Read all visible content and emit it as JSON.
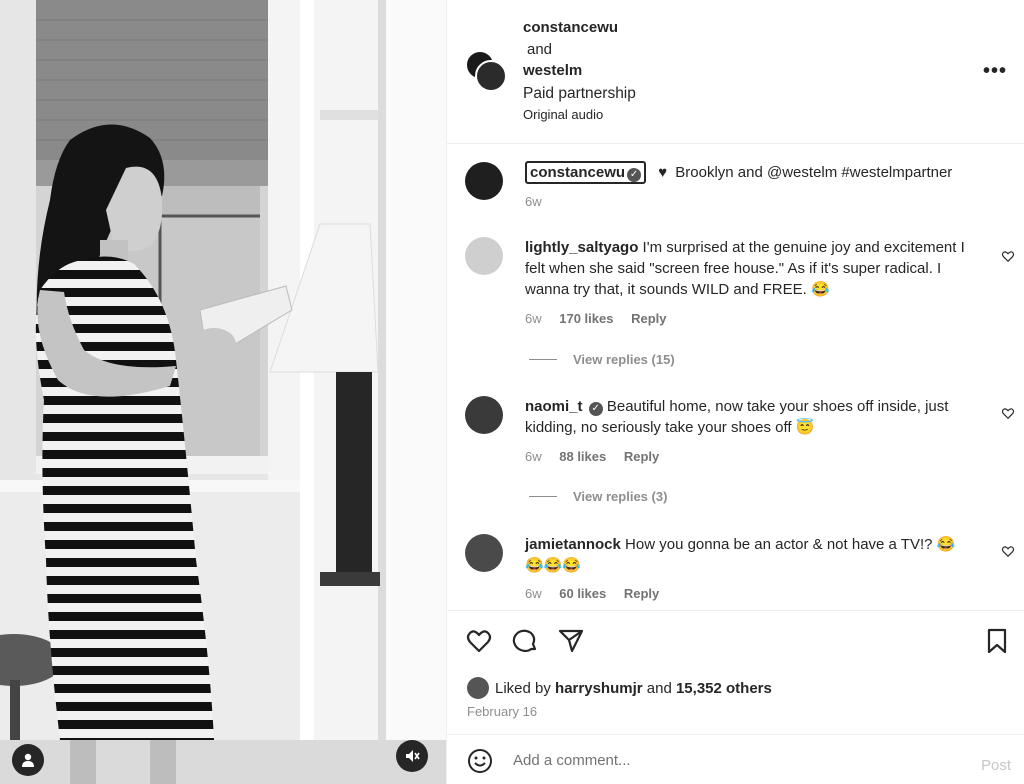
{
  "header": {
    "user1": "constancewu",
    "conjunction": "and",
    "user2": "westelm",
    "label": "Paid partnership",
    "audio": "Original audio",
    "more": "•••"
  },
  "caption": {
    "username": "constancewu",
    "text": "Brooklyn and @westelm #westelmpartner",
    "age": "6w"
  },
  "comments": [
    {
      "username": "lightly_saltyago",
      "text": "I'm surprised at the genuine joy and excitement I felt when she said \"screen free house.\" As if it's super radical. I wanna try that, it sounds WILD and FREE. 😂",
      "age": "6w",
      "likes": "170 likes",
      "reply": "Reply",
      "view_replies": "View replies (15)"
    },
    {
      "username": "naomi_t",
      "text": "Beautiful home, now take your shoes off inside, just kidding, no seriously take your shoes off 😇",
      "age": "6w",
      "likes": "88 likes",
      "reply": "Reply",
      "view_replies": "View replies (3)"
    },
    {
      "username": "jamietannock",
      "text": "How you gonna be an actor & not have a TV!? 😂😂😂😂",
      "age": "6w",
      "likes": "60 likes",
      "reply": "Reply"
    }
  ],
  "likes": {
    "prefix": "Liked by",
    "user": "harryshumjr",
    "middle": "and",
    "count": "15,352 others"
  },
  "date": "February 16",
  "add_comment": {
    "placeholder": "Add a comment...",
    "post": "Post"
  }
}
